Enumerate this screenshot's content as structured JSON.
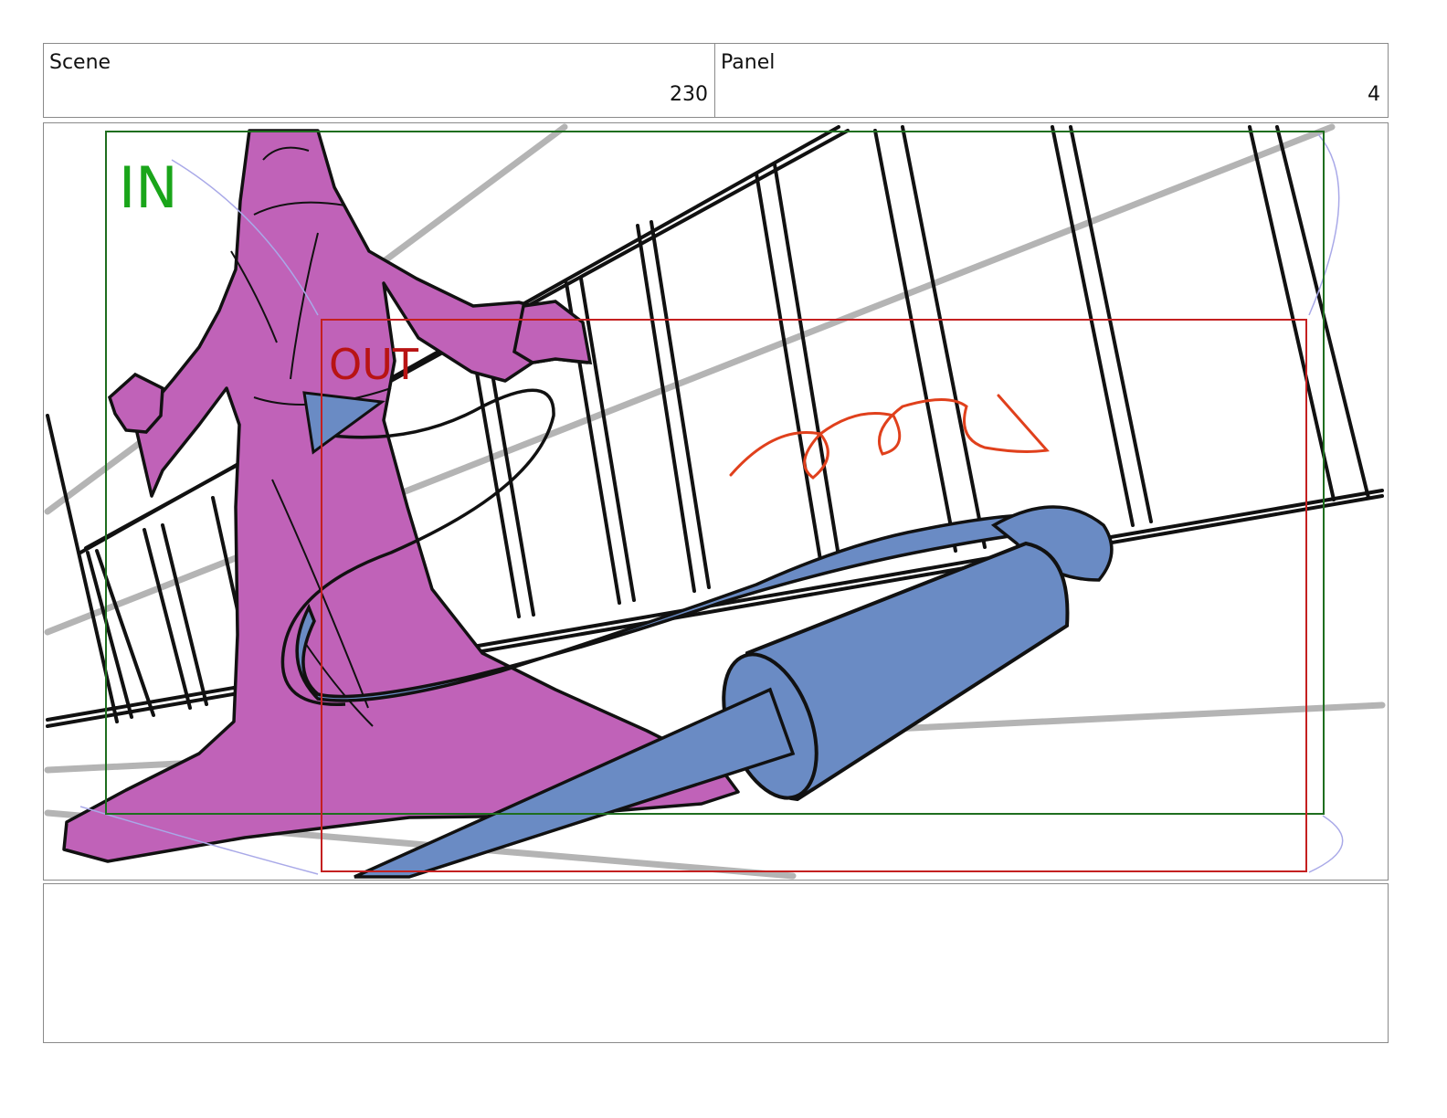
{
  "header": {
    "scene_label": "Scene",
    "scene_number": "230",
    "panel_label": "Panel",
    "panel_number": "4"
  },
  "frame": {
    "in_label": "IN",
    "out_label": "OUT",
    "in_color": "#1f6e1f",
    "out_color": "#c42020",
    "figure_color": "#c062b8",
    "object_color": "#6a8bc4",
    "motion_scribble_color": "#e0401c"
  },
  "notes": {
    "text": ""
  }
}
